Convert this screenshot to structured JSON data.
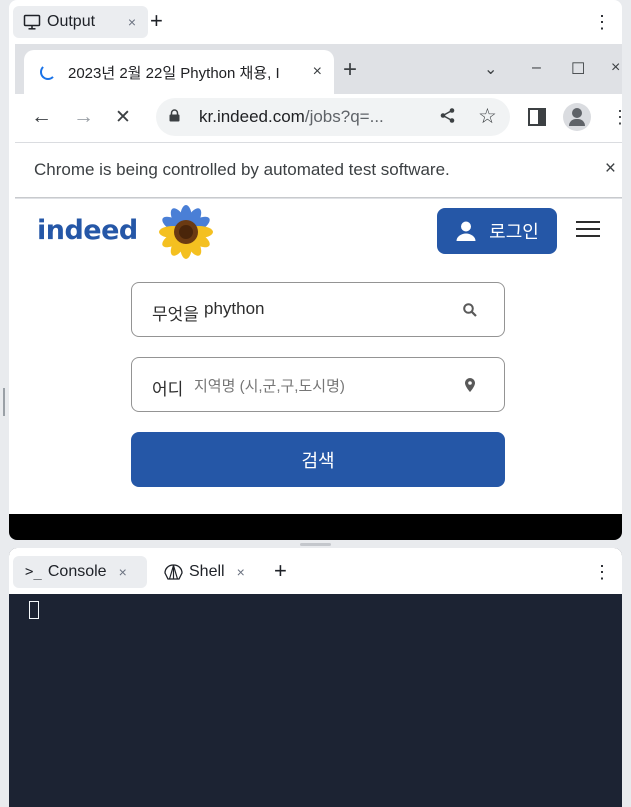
{
  "output_panel": {
    "tab_label": "Output",
    "close_glyph": "×",
    "add_glyph": "+",
    "menu_glyph": "⋮"
  },
  "browser": {
    "tab_title": "2023년 2월 22일 Phython 채용, I",
    "tab_close": "×",
    "new_tab": "+",
    "win_dropdown": "⌄",
    "win_minimize": "–",
    "win_maximize": "☐",
    "win_close": "×",
    "back": "←",
    "forward": "→",
    "stop": "✕",
    "url_host": "kr.indeed.com",
    "url_path": "/jobs?q=...",
    "menu": "⋮",
    "infobar_message": "Chrome is being controlled by automated test software.",
    "infobar_close": "×"
  },
  "page": {
    "logo": "indeed",
    "signin_label": "로그인",
    "what_label": "무엇을",
    "what_value": "phython",
    "where_label": "어디",
    "where_placeholder": "지역명 (시,군,구,도시명)",
    "search_button": "검색"
  },
  "console_panel": {
    "console_tab": "Console",
    "shell_tab": "Shell",
    "close_glyph": "×",
    "add_glyph": "+",
    "menu_glyph": "⋮"
  },
  "colors": {
    "indeed_blue": "#2557a7",
    "console_bg": "#1c2333",
    "chrome_tab_strip": "#dfe1e5"
  }
}
